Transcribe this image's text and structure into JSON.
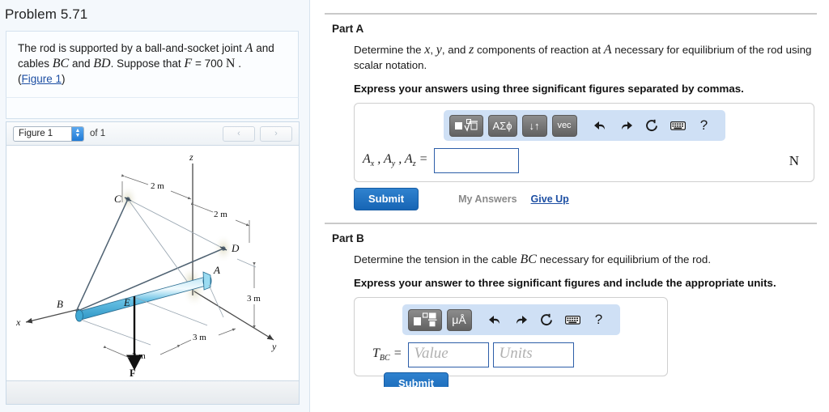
{
  "problem": {
    "title": "Problem 5.71",
    "statement_pre": "The rod is supported by a ball-and-socket joint ",
    "statement_A": "A",
    "statement_mid": " and cables ",
    "statement_BC": "BC",
    "statement_and": " and ",
    "statement_BD": "BD",
    "statement_suppose": ". Suppose that ",
    "statement_F": "F",
    "statement_val": " = 700 ",
    "statement_N": "N",
    "statement_period": " .",
    "figure_link_open": "(",
    "figure_link": "Figure 1",
    "figure_link_close": ")"
  },
  "figure_nav": {
    "select_value": "Figure 1",
    "of_label": "of 1",
    "prev_label": "‹",
    "next_label": "›"
  },
  "figure": {
    "labels": {
      "z_axis": "z",
      "x_axis": "x",
      "y_axis": "y",
      "point_A": "A",
      "point_B": "B",
      "point_C": "C",
      "point_D": "D",
      "point_E": "E",
      "force_F": "F",
      "dim_CZ": "2 m",
      "dim_ZD": "2 m",
      "dim_D_down": "3 m",
      "dim_AE": "3 m",
      "dim_BE": "3 m"
    }
  },
  "part_a": {
    "heading": "Part A",
    "question_pre": "Determine the ",
    "question_x": "x",
    "question_c1": ", ",
    "question_y": "y",
    "question_c2": ", and ",
    "question_z": "z",
    "question_mid": " components of reaction at ",
    "question_A": "A",
    "question_post": " necessary for equilibrium of the rod using scalar notation.",
    "instruction": "Express your answers using three significant figures separated by commas.",
    "toolbar": {
      "template_btn": "template-radical",
      "greek_btn": "ΑΣϕ",
      "arrows_btn": "↓↑",
      "vec_btn": "vec",
      "undo_icon": "undo-arrow-icon",
      "redo_icon": "redo-arrow-icon",
      "reset_icon": "reset-circle-icon",
      "keyboard_icon": "keyboard-icon",
      "help_icon": "?"
    },
    "answer_label_A": "A",
    "answer_sub_x": "x",
    "answer_sub_y": "y",
    "answer_sub_z": "z",
    "answer_comma": " , ",
    "answer_equals": " = ",
    "answer_value": "",
    "answer_placeholder": "",
    "unit_suffix": "N",
    "submit_label": "Submit",
    "my_answers_label": "My Answers",
    "give_up_label": "Give Up"
  },
  "part_b": {
    "heading": "Part B",
    "question_pre": "Determine the tension in the cable ",
    "question_BC": "BC",
    "question_post": " necessary for equilibrium of the rod.",
    "instruction": "Express your answer to three significant figures and include the appropriate units.",
    "toolbar": {
      "template_btn": "template-fraction",
      "units_btn": "μÅ",
      "undo_icon": "undo-arrow-icon",
      "redo_icon": "redo-arrow-icon",
      "reset_icon": "reset-circle-icon",
      "keyboard_icon": "keyboard-icon",
      "help_icon": "?"
    },
    "answer_label_T": "T",
    "answer_sub_BC": "BC",
    "answer_equals": " = ",
    "value_placeholder": "Value",
    "units_placeholder": "Units",
    "value_text": "",
    "units_text": "",
    "submit_label": "Submit"
  },
  "colors": {
    "accent_blue": "#1765b5",
    "link_blue": "#1d4fa3",
    "toolbar_bg": "#cfe0f5",
    "rod_blue": "#56b7e0",
    "panel_bg": "#f4f8fc"
  }
}
